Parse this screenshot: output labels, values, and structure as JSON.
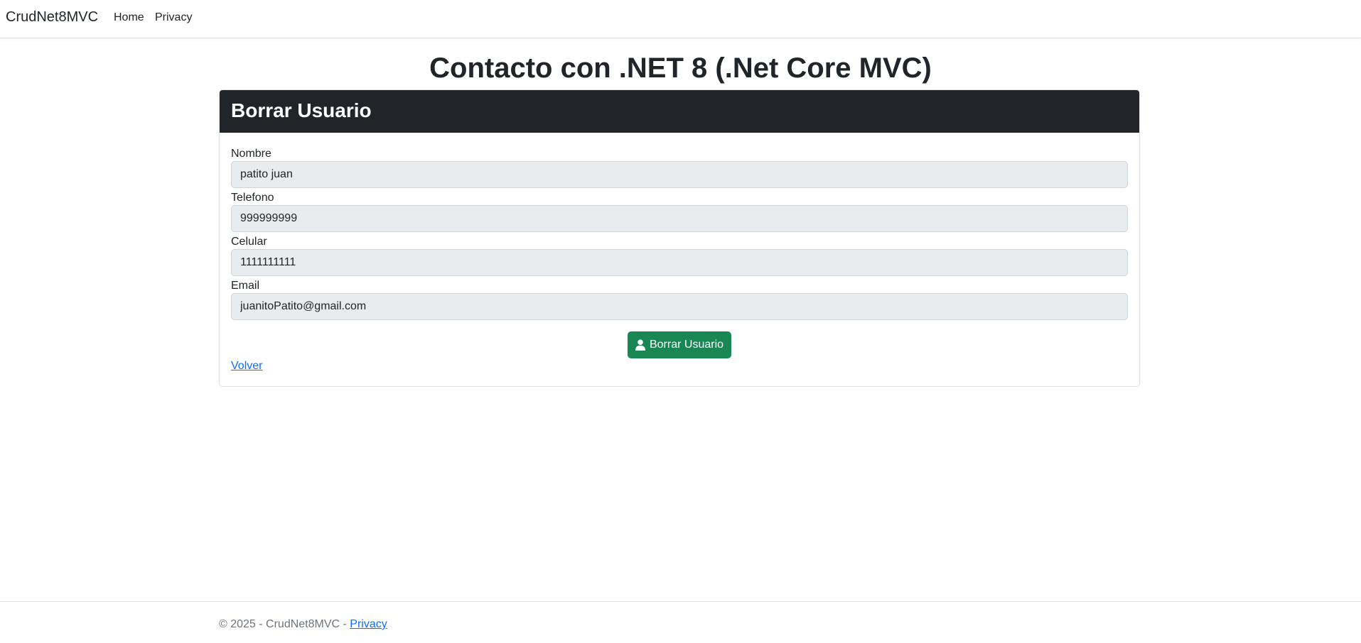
{
  "navbar": {
    "brand": "CrudNet8MVC",
    "links": [
      "Home",
      "Privacy"
    ]
  },
  "page": {
    "title": "Contacto con .NET 8 (.Net Core MVC)"
  },
  "card": {
    "header": "Borrar Usuario",
    "fields": [
      {
        "label": "Nombre",
        "value": "patito juan"
      },
      {
        "label": "Telefono",
        "value": "999999999"
      },
      {
        "label": "Celular",
        "value": "1111111111"
      },
      {
        "label": "Email",
        "value": "juanitoPatito@gmail.com"
      }
    ],
    "submit_label": "Borrar Usuario",
    "submit_icon": "user-icon",
    "back_label": "Volver"
  },
  "footer": {
    "text": "© 2025 - CrudNet8MVC - ",
    "link": "Privacy"
  },
  "colors": {
    "header_bg": "#212529",
    "button_bg": "#198754",
    "link": "#0d6efd",
    "input_bg": "#e9ecef"
  }
}
